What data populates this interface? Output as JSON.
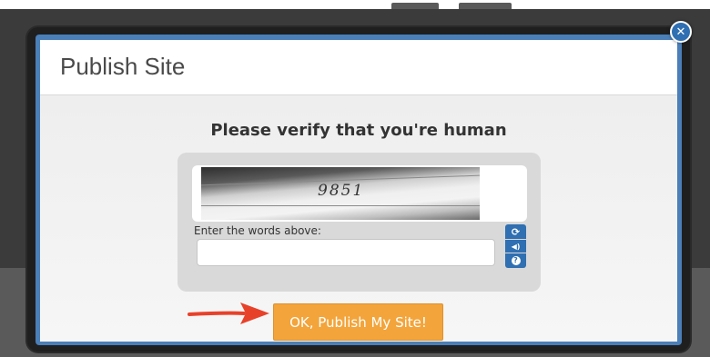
{
  "modal": {
    "title": "Publish Site",
    "close_icon": "close-icon",
    "close_glyph": "✕"
  },
  "captcha": {
    "heading": "Please verify that you're human",
    "image_text": "9851",
    "label": "Enter the words above:",
    "input_value": "",
    "refresh_icon": "refresh-icon",
    "refresh_glyph": "⟳",
    "audio_icon": "audio-icon",
    "audio_glyph": "◀)",
    "help_icon": "help-icon",
    "help_glyph": "?"
  },
  "actions": {
    "publish_label": "OK, Publish My Site!"
  },
  "annotation": {
    "arrow_icon": "arrow-icon",
    "arrow_color": "#e8412a"
  },
  "colors": {
    "accent_orange": "#f3a43a",
    "modal_border": "#4a7fb8",
    "captcha_button": "#2f6fb2"
  }
}
